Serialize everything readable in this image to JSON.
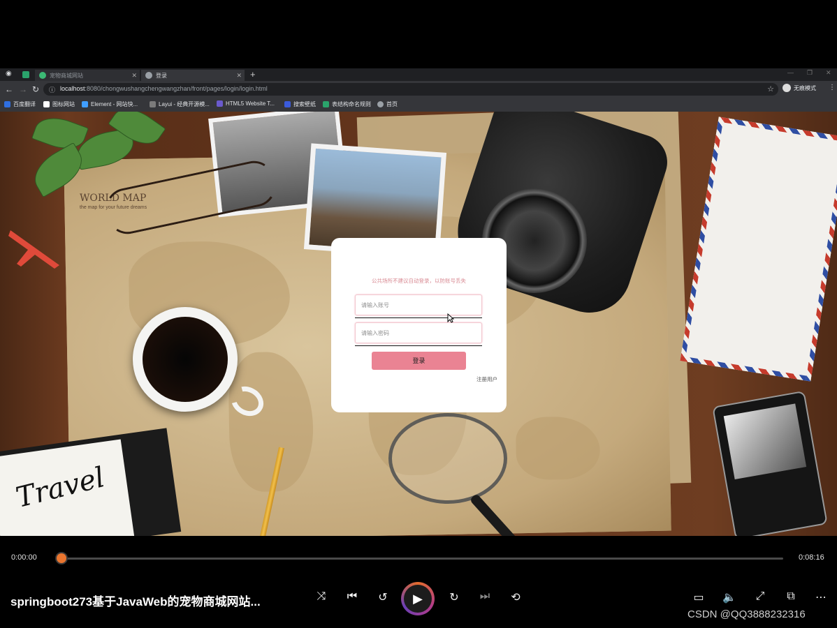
{
  "browser": {
    "tabs": [
      {
        "title": "宠物商城网站",
        "active": false
      },
      {
        "title": "登录",
        "active": true
      }
    ],
    "url_host": "localhost",
    "url_rest": ":8080/chongwushangchengwangzhan/front/pages/login/login.html",
    "profile_label": "无痕模式",
    "bookmarks": [
      "百度翻译",
      "图标网站",
      "Element - 网站快...",
      "Layui - 经典开源模...",
      "HTML5 Website T...",
      "搜索壁纸",
      "表结构命名规则",
      "首页"
    ]
  },
  "page": {
    "worldmap_title": "WORLD MAP",
    "worldmap_sub": "the map for your future dreams",
    "notebook_text": "Travel"
  },
  "login": {
    "notice": "公共场所不建议自动登录，以防账号丢失",
    "username_placeholder": "请输入账号",
    "password_placeholder": "请输入密码",
    "login_label": "登录",
    "register_label": "注册用户"
  },
  "player": {
    "current_time": "0:00:00",
    "total_time": "0:08:16",
    "progress": 0,
    "title": "springboot273基于JavaWeb的宠物商城网站...",
    "icons": [
      "shuffle-icon",
      "skip-previous-icon",
      "rewind-10-icon",
      "play-icon",
      "forward-30-icon",
      "skip-next-icon",
      "repeat-icon",
      "subtitles-icon",
      "volume-icon",
      "fullscreen-icon",
      "miniplayer-icon",
      "more-icon"
    ]
  },
  "watermark": "CSDN @QQ3888232316",
  "colors": {
    "accent_pink": "#ea8393",
    "progress_orange": "#e9752f"
  }
}
